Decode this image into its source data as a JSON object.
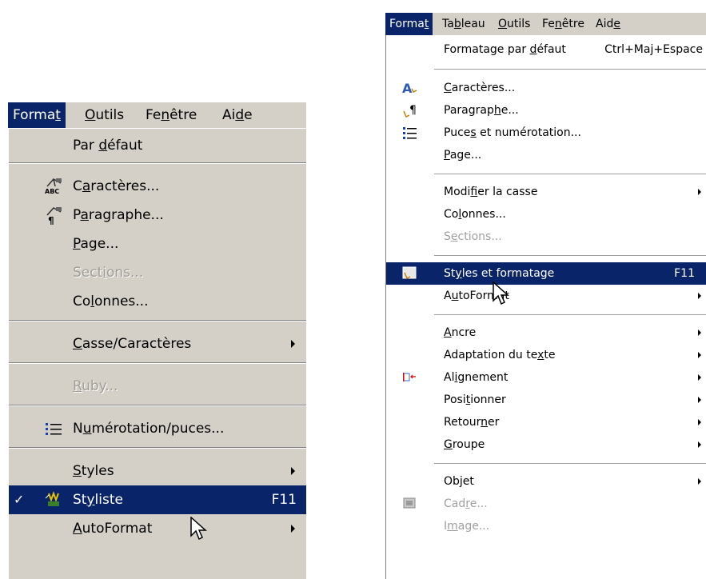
{
  "left_menu": {
    "menubar": [
      "Format",
      "Outils",
      "Fenêtre",
      "Aide"
    ],
    "items": {
      "par_defaut": "Par défaut",
      "caracteres": "Caractères...",
      "paragraphe": "Paragraphe...",
      "page": "Page...",
      "sections": "Sections...",
      "colonnes": "Colonnes...",
      "casse": "Casse/Caractères",
      "ruby": "Ruby...",
      "numerotation": "Numérotation/puces...",
      "styles": "Styles",
      "styliste": "Styliste",
      "styliste_shortcut": "F11",
      "autoformat": "AutoFormat"
    }
  },
  "right_menu": {
    "menubar": [
      "Format",
      "Tableau",
      "Outils",
      "Fenêtre",
      "Aide"
    ],
    "items": {
      "formatage_defaut": "Formatage par défaut",
      "formatage_defaut_shortcut": "Ctrl+Maj+Espace",
      "caracteres": "Caractères...",
      "paragraphe": "Paragraphe...",
      "puces": "Puces et numérotation...",
      "page": "Page...",
      "modifier_casse": "Modifier la casse",
      "colonnes": "Colonnes...",
      "sections": "Sections...",
      "styles_formatage": "Styles et formatage",
      "styles_formatage_shortcut": "F11",
      "autoformat": "AutoFormat",
      "ancre": "Ancre",
      "adaptation": "Adaptation du texte",
      "alignement": "Alignement",
      "positionner": "Positionner",
      "retourner": "Retourner",
      "groupe": "Groupe",
      "objet": "Objet",
      "cadre": "Cadre...",
      "image": "Image..."
    }
  },
  "colors": {
    "highlight": "#0a246a",
    "menu_bg": "#d4d0c8",
    "disabled_text": "#a09d96"
  },
  "icons": [
    "abc-characters-icon",
    "paragraph-icon",
    "list-bullets-icon",
    "checkmark-icon",
    "stylist-icon",
    "font-characters-icon",
    "paragraph-hand-icon",
    "bullets-numbering-icon",
    "styles-formatting-icon",
    "alignment-icon",
    "frame-icon",
    "mouse-cursor-icon"
  ]
}
